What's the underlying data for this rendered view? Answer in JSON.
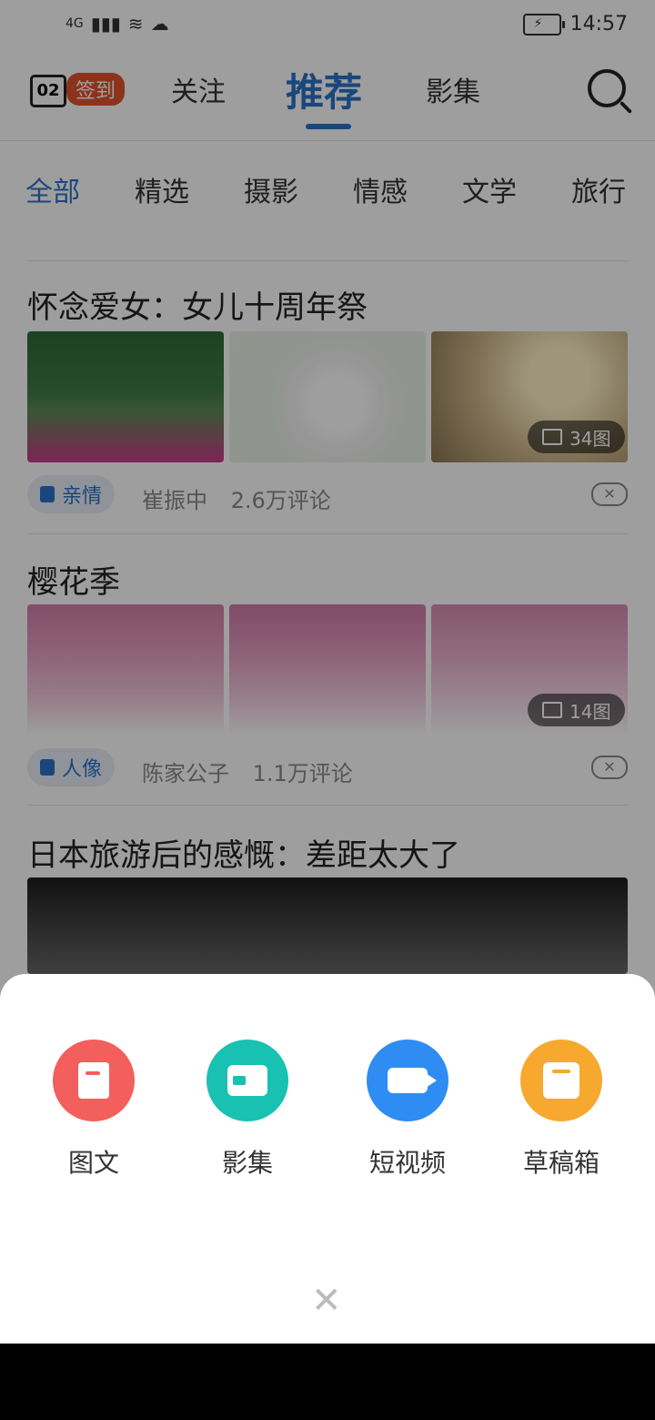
{
  "status_bar": {
    "network": "4G",
    "time": "14:57"
  },
  "top_nav": {
    "calendar_day": "02",
    "checkin_label": "签到",
    "tabs": [
      "关注",
      "推荐",
      "影集"
    ]
  },
  "categories": [
    "全部",
    "精选",
    "摄影",
    "情感",
    "文学",
    "旅行"
  ],
  "feed": [
    {
      "title": "怀念爱女：女儿十周年祭",
      "tag": "亲情",
      "author": "崔振中",
      "comments": "2.6万评论",
      "image_count": "34图"
    },
    {
      "title": "樱花季",
      "tag": "人像",
      "author": "陈家公子",
      "comments": "1.1万评论",
      "image_count": "14图"
    },
    {
      "title": "日本旅游后的感慨：差距太大了"
    }
  ],
  "bottom_sheet": {
    "actions": [
      {
        "label": "图文",
        "icon": "document-icon",
        "color": "#f25f5c"
      },
      {
        "label": "影集",
        "icon": "gallery-music-icon",
        "color": "#19c1b2"
      },
      {
        "label": "短视频",
        "icon": "video-camera-icon",
        "color": "#2f8cf3"
      },
      {
        "label": "草稿箱",
        "icon": "drafts-box-icon",
        "color": "#f6a92e"
      }
    ],
    "close_label": "✕"
  }
}
